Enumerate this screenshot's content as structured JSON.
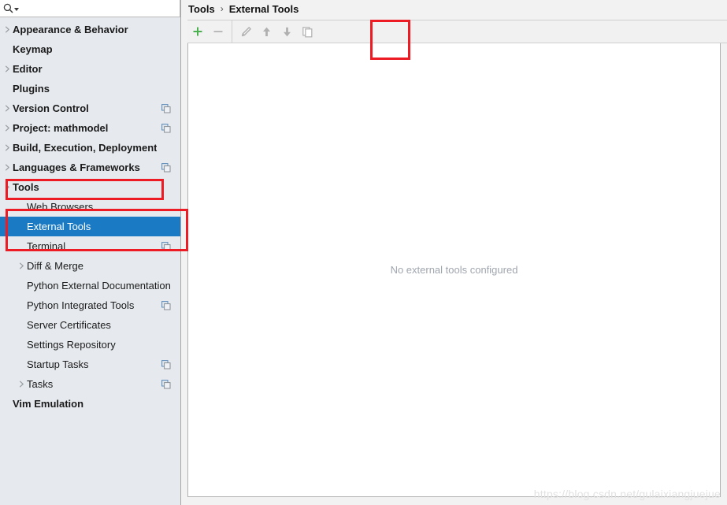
{
  "search": {
    "placeholder": "",
    "value": "",
    "icon": "search-icon",
    "caret_icon": "chevron-down-icon"
  },
  "sidebar": {
    "items": [
      {
        "label": "Appearance & Behavior",
        "arrow": true,
        "bold": true,
        "indent": 0,
        "copy": false,
        "selected": false
      },
      {
        "label": "Keymap",
        "arrow": false,
        "bold": true,
        "indent": 0,
        "copy": false,
        "selected": false
      },
      {
        "label": "Editor",
        "arrow": true,
        "bold": true,
        "indent": 0,
        "copy": false,
        "selected": false
      },
      {
        "label": "Plugins",
        "arrow": false,
        "bold": true,
        "indent": 0,
        "copy": false,
        "selected": false
      },
      {
        "label": "Version Control",
        "arrow": true,
        "bold": true,
        "indent": 0,
        "copy": true,
        "selected": false
      },
      {
        "label": "Project: mathmodel",
        "arrow": true,
        "bold": true,
        "indent": 0,
        "copy": true,
        "selected": false
      },
      {
        "label": "Build, Execution, Deployment",
        "arrow": true,
        "bold": true,
        "indent": 0,
        "copy": false,
        "selected": false
      },
      {
        "label": "Languages & Frameworks",
        "arrow": true,
        "bold": true,
        "indent": 0,
        "copy": true,
        "selected": false
      },
      {
        "label": "Tools",
        "arrow": true,
        "bold": true,
        "indent": 0,
        "copy": false,
        "selected": false
      },
      {
        "label": "Web Browsers",
        "arrow": false,
        "bold": false,
        "indent": 1,
        "copy": false,
        "selected": false
      },
      {
        "label": "External Tools",
        "arrow": false,
        "bold": false,
        "indent": 1,
        "copy": false,
        "selected": true
      },
      {
        "label": "Terminal",
        "arrow": false,
        "bold": false,
        "indent": 1,
        "copy": true,
        "selected": false
      },
      {
        "label": "Diff & Merge",
        "arrow": true,
        "bold": false,
        "indent": 1,
        "copy": false,
        "selected": false
      },
      {
        "label": "Python External Documentation",
        "arrow": false,
        "bold": false,
        "indent": 1,
        "copy": false,
        "selected": false
      },
      {
        "label": "Python Integrated Tools",
        "arrow": false,
        "bold": false,
        "indent": 1,
        "copy": true,
        "selected": false
      },
      {
        "label": "Server Certificates",
        "arrow": false,
        "bold": false,
        "indent": 1,
        "copy": false,
        "selected": false
      },
      {
        "label": "Settings Repository",
        "arrow": false,
        "bold": false,
        "indent": 1,
        "copy": false,
        "selected": false
      },
      {
        "label": "Startup Tasks",
        "arrow": false,
        "bold": false,
        "indent": 1,
        "copy": true,
        "selected": false
      },
      {
        "label": "Tasks",
        "arrow": true,
        "bold": false,
        "indent": 1,
        "copy": true,
        "selected": false
      },
      {
        "label": "Vim Emulation",
        "arrow": false,
        "bold": true,
        "indent": 0,
        "copy": false,
        "selected": false
      }
    ]
  },
  "breadcrumb": {
    "root": "Tools",
    "separator": "›",
    "current": "External Tools"
  },
  "toolbar": {
    "buttons": [
      {
        "name": "add-button",
        "icon": "plus-icon",
        "enabled": true
      },
      {
        "name": "remove-button",
        "icon": "minus-icon",
        "enabled": false
      },
      {
        "name": "edit-button",
        "icon": "pencil-icon",
        "enabled": false
      },
      {
        "name": "move-up-button",
        "icon": "arrow-up-icon",
        "enabled": false
      },
      {
        "name": "move-down-button",
        "icon": "arrow-down-icon",
        "enabled": false
      },
      {
        "name": "copy-button",
        "icon": "copy-icon",
        "enabled": false
      }
    ]
  },
  "main": {
    "empty_message": "No external tools configured"
  },
  "watermark": {
    "text": "https://blog.csdn.net/gulaixiangjuejue"
  },
  "annotations": {
    "tools_box": "highlight-tools",
    "external_tools_box": "highlight-external-tools",
    "add_button_box": "highlight-add-button"
  },
  "colors": {
    "selection": "#1b7ac4",
    "annotation": "#ed1c24",
    "sidebar_bg": "#e6eaee",
    "plus_green": "#4caf50"
  }
}
